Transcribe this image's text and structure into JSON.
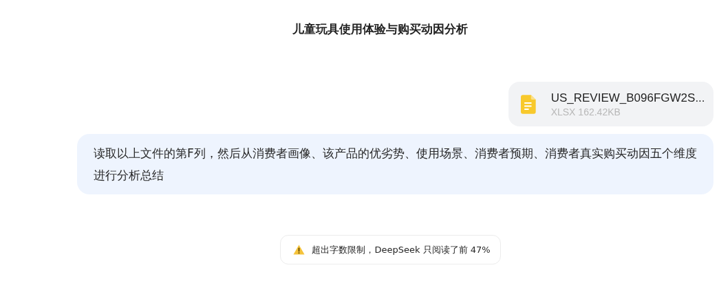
{
  "title": "儿童玩具使用体验与购买动因分析",
  "attachment": {
    "name": "US_REVIEW_B096FGW2S...",
    "meta": "XLSX 162.42KB"
  },
  "message": "读取以上文件的第F列，然后从消费者画像、该产品的优劣势、使用场景、消费者预期、消费者真实购买动因五个维度进行分析总结",
  "notice": {
    "kind": "warning",
    "text": "超出字数限制，DeepSeek 只阅读了前 47%"
  }
}
